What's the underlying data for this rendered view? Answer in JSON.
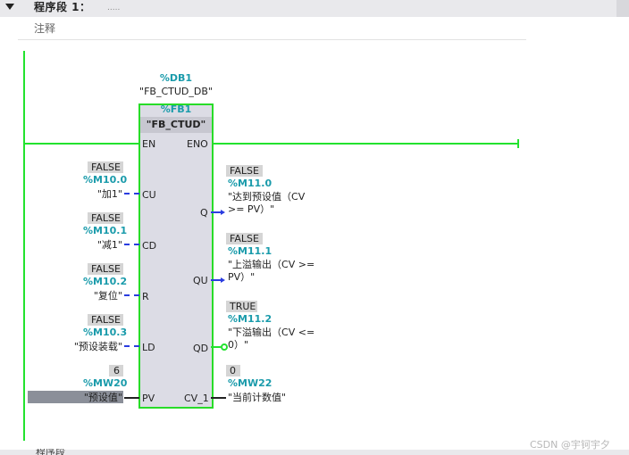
{
  "network": {
    "title": "程序段 1：",
    "dots": ".....",
    "comment_label": "注释"
  },
  "instance": {
    "db_addr": "%DB1",
    "db_name": "\"FB_CTUD_DB\""
  },
  "block": {
    "fb_addr": "%FB1",
    "fb_name": "\"FB_CTUD\"",
    "en": "EN",
    "eno": "ENO"
  },
  "inputs": [
    {
      "pin": "CU",
      "value": "FALSE",
      "addr": "%M10.0",
      "name": "\"加1\""
    },
    {
      "pin": "CD",
      "value": "FALSE",
      "addr": "%M10.1",
      "name": "\"减1\""
    },
    {
      "pin": "R",
      "value": "FALSE",
      "addr": "%M10.2",
      "name": "\"复位\""
    },
    {
      "pin": "LD",
      "value": "FALSE",
      "addr": "%M10.3",
      "name": "\"预设装载\""
    },
    {
      "pin": "PV",
      "value": "6",
      "addr": "%MW20",
      "name": "\"预设值\""
    }
  ],
  "outputs": [
    {
      "pin": "Q",
      "value": "FALSE",
      "addr": "%M11.0",
      "name_l1": "\"达到预设值（CV",
      "name_l2": ">= PV）\""
    },
    {
      "pin": "QU",
      "value": "FALSE",
      "addr": "%M11.1",
      "name_l1": "\"上溢输出（CV >=",
      "name_l2": "PV）\""
    },
    {
      "pin": "QD",
      "value": "TRUE",
      "addr": "%M11.2",
      "name_l1": "\"下溢输出（CV <=",
      "name_l2": "0）\""
    },
    {
      "pin": "CV_1",
      "value": "0",
      "addr": "%MW22",
      "name": "\"当前计数值\""
    }
  ],
  "footer": {
    "next_network_stub": "程序段",
    "watermark": "CSDN @宇钶宇夕"
  },
  "colors": {
    "energized": "#22e22e",
    "not_energized": "#2a3ce0",
    "address": "#1a9bab",
    "block_fill": "#dcdce5"
  }
}
